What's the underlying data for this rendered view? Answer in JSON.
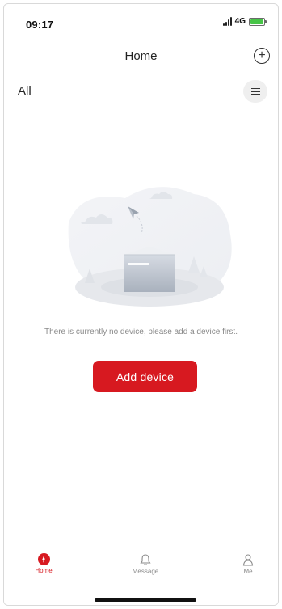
{
  "status_bar": {
    "time": "09:17",
    "network": "4G",
    "battery_color": "#47c447"
  },
  "header": {
    "title": "Home",
    "add_icon": "plus-circle-icon"
  },
  "filter": {
    "label": "All",
    "menu_icon": "hamburger-menu-icon"
  },
  "empty_state": {
    "illustration": "empty-box-illustration",
    "message": "There is currently no device, please add a device first.",
    "button_label": "Add device",
    "button_color": "#d71920"
  },
  "bottom_nav": {
    "items": [
      {
        "label": "Home",
        "icon": "home-bolt-icon",
        "active": true
      },
      {
        "label": "Message",
        "icon": "bell-icon",
        "active": false
      },
      {
        "label": "Me",
        "icon": "person-icon",
        "active": false
      }
    ]
  }
}
